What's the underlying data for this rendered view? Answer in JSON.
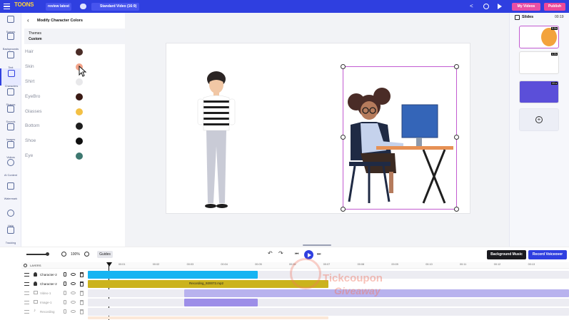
{
  "topbar": {
    "logo": "TOONS",
    "project_name": "review latest",
    "resolution": "Standard Video (16:9)",
    "my_videos": "My Videos",
    "publish": "Publish",
    "colors": {
      "bar": "#2f3fe0",
      "my_videos": "#e94fa5",
      "publish": "#ec4899"
    }
  },
  "leftnav": {
    "items": [
      {
        "label": "Scenes",
        "icon": "scenes-icon"
      },
      {
        "label": "Backgrounds",
        "icon": "backgrounds-icon"
      },
      {
        "label": "Text",
        "icon": "text-icon"
      },
      {
        "label": "Characters",
        "icon": "characters-icon"
      },
      {
        "label": "Shapes",
        "icon": "shapes-icon"
      },
      {
        "label": "Sounds",
        "icon": "sounds-icon"
      },
      {
        "label": "Images",
        "icon": "images-icon"
      },
      {
        "label": "Videos",
        "icon": "videos-icon"
      },
      {
        "label": "AI Content",
        "icon": "ai-content-icon"
      },
      {
        "label": "Watermark",
        "icon": "watermark-icon"
      },
      {
        "label": "Help",
        "icon": "help-icon"
      },
      {
        "label": "Tracking",
        "icon": "tracking-icon"
      }
    ],
    "active": "Characters"
  },
  "panel": {
    "title": "Modify Character Colors",
    "theme_label": "Themes",
    "theme_value": "Custom",
    "colors": [
      {
        "label": "Hair",
        "color": "#4a2c27"
      },
      {
        "label": "Skin",
        "color": "#f3a389"
      },
      {
        "label": "Shirt",
        "color": "#e8e8ea"
      },
      {
        "label": "EyeBro",
        "color": "#3a1a14"
      },
      {
        "label": "Glasses",
        "color": "#f3c044"
      },
      {
        "label": "Bottom",
        "color": "#1e1e1e"
      },
      {
        "label": "Shoe",
        "color": "#0f0f0f"
      },
      {
        "label": "Eye",
        "color": "#3e7870"
      }
    ]
  },
  "rightpanel": {
    "title": "Slides",
    "duration": "00:19",
    "slides": [
      {
        "badge": "5.0s"
      },
      {
        "badge": "4.0s"
      },
      {
        "badge": "10.s"
      }
    ]
  },
  "transport": {
    "zoom": "100%",
    "guides": "Guides",
    "background_music": "Background Music",
    "record_voiceover": "Record Voiceover"
  },
  "timeline": {
    "layers_label": "LAYERS",
    "ruler": [
      "00:01",
      "00:02",
      "00:03",
      "00:04",
      "00:05",
      "00:06",
      "00:07",
      "00:08",
      "00:09",
      "00:10",
      "00:11",
      "00:12",
      "00:13"
    ],
    "rows": [
      {
        "name": "Character-2"
      },
      {
        "name": "Character-2"
      },
      {
        "name": "Video-1"
      },
      {
        "name": "Image-1"
      },
      {
        "name": "Recording"
      }
    ],
    "audio_clip": "Recording_920072.mp2"
  },
  "watermark": {
    "line1": "Tickcoupon",
    "line2": "Giveaway"
  }
}
